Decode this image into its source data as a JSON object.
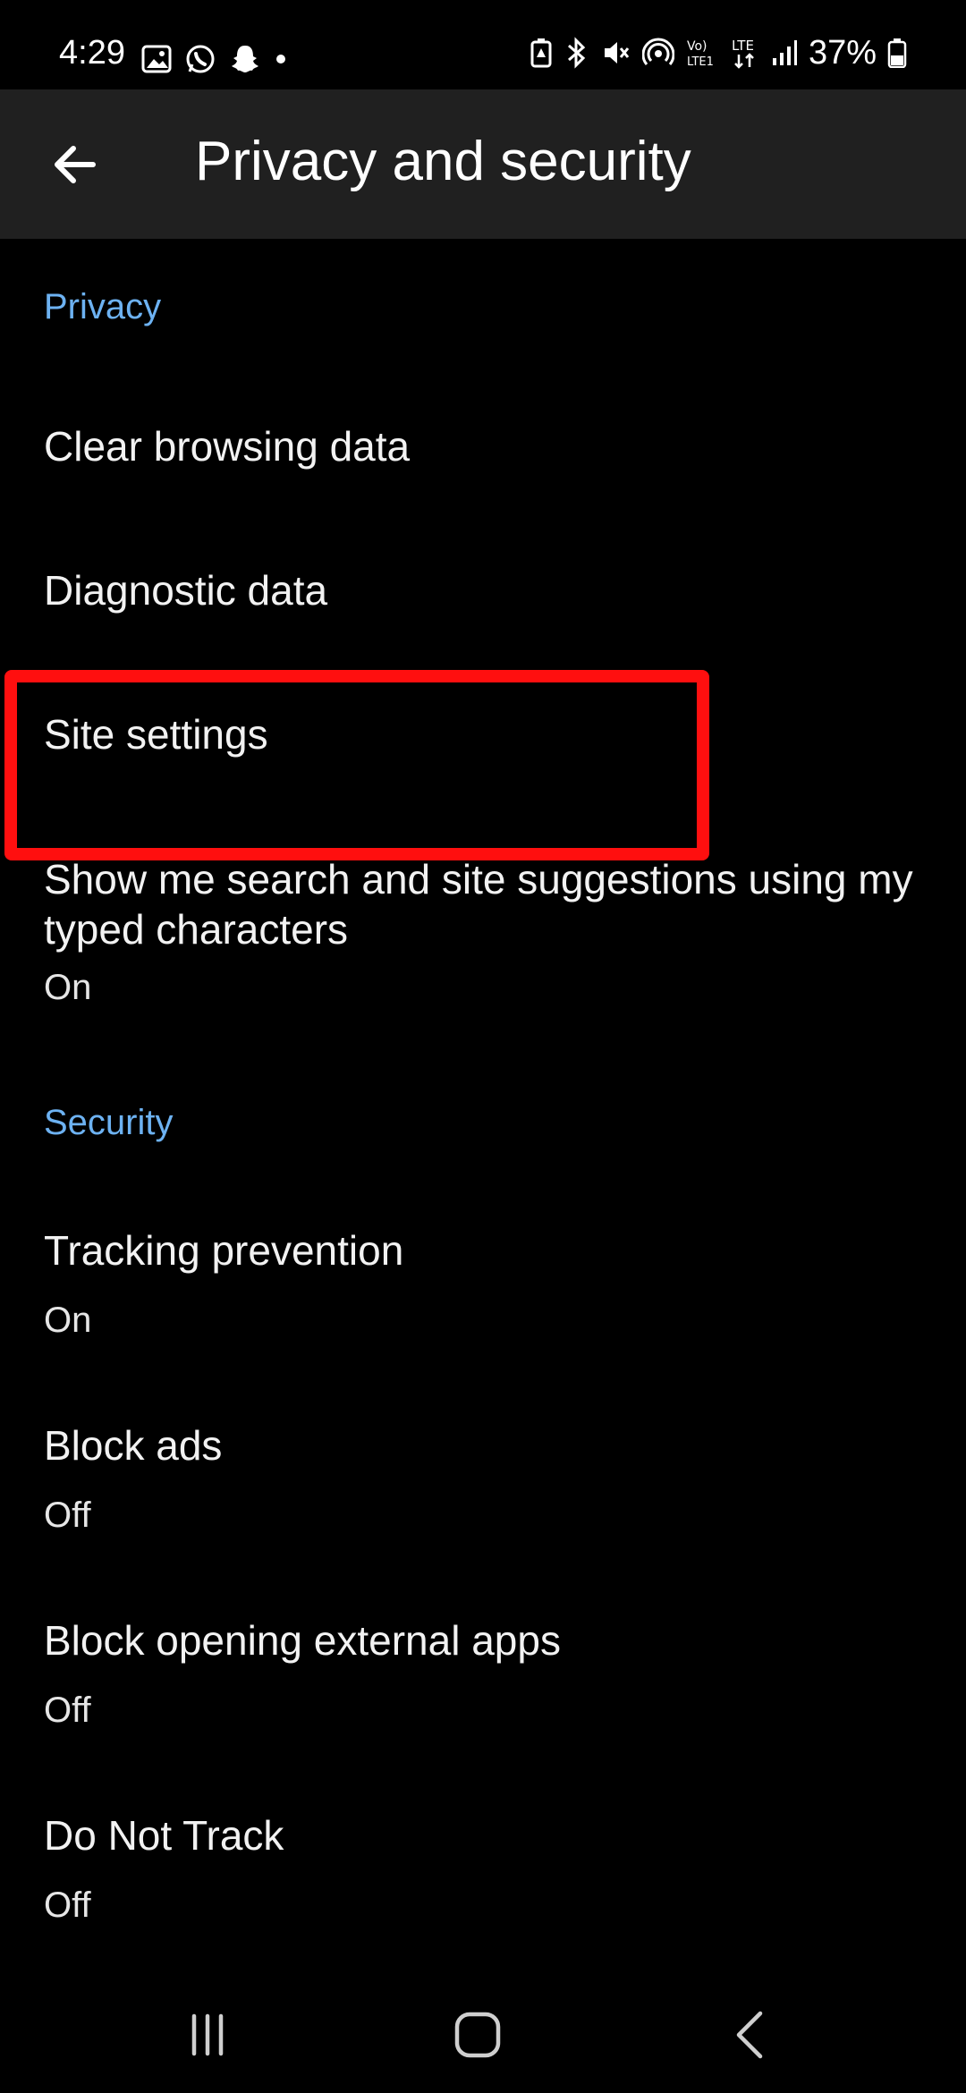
{
  "status_bar": {
    "time": "4:29",
    "battery": "37%",
    "left_icons": [
      "gallery-icon",
      "whatsapp-icon",
      "snapchat-icon",
      "dot-icon"
    ],
    "right_icons": [
      "battery-saver-icon",
      "bluetooth-icon",
      "mute-icon",
      "hotspot-icon",
      "volte-icon",
      "lte-icon",
      "signal-icon",
      "battery-icon"
    ]
  },
  "header": {
    "title": "Privacy and security",
    "back_icon": "back-arrow-icon"
  },
  "sections": {
    "privacy": {
      "label": "Privacy",
      "items": [
        {
          "title": "Clear browsing data"
        },
        {
          "title": "Diagnostic data"
        },
        {
          "title": "Site settings"
        },
        {
          "title": "Show me search and site suggestions using my typed characters",
          "subtitle": "On"
        }
      ]
    },
    "security": {
      "label": "Security",
      "items": [
        {
          "title": "Tracking prevention",
          "subtitle": "On"
        },
        {
          "title": "Block ads",
          "subtitle": "Off"
        },
        {
          "title": "Block opening external apps",
          "subtitle": "Off"
        },
        {
          "title": "Do Not Track",
          "subtitle": "Off"
        }
      ]
    }
  },
  "nav_bar": {
    "buttons": [
      "recents-icon",
      "home-icon",
      "back-icon"
    ]
  },
  "colors": {
    "background": "#000000",
    "app_bar": "#202020",
    "section_header": "#6db2f2",
    "highlight": "#ff0f0f"
  }
}
